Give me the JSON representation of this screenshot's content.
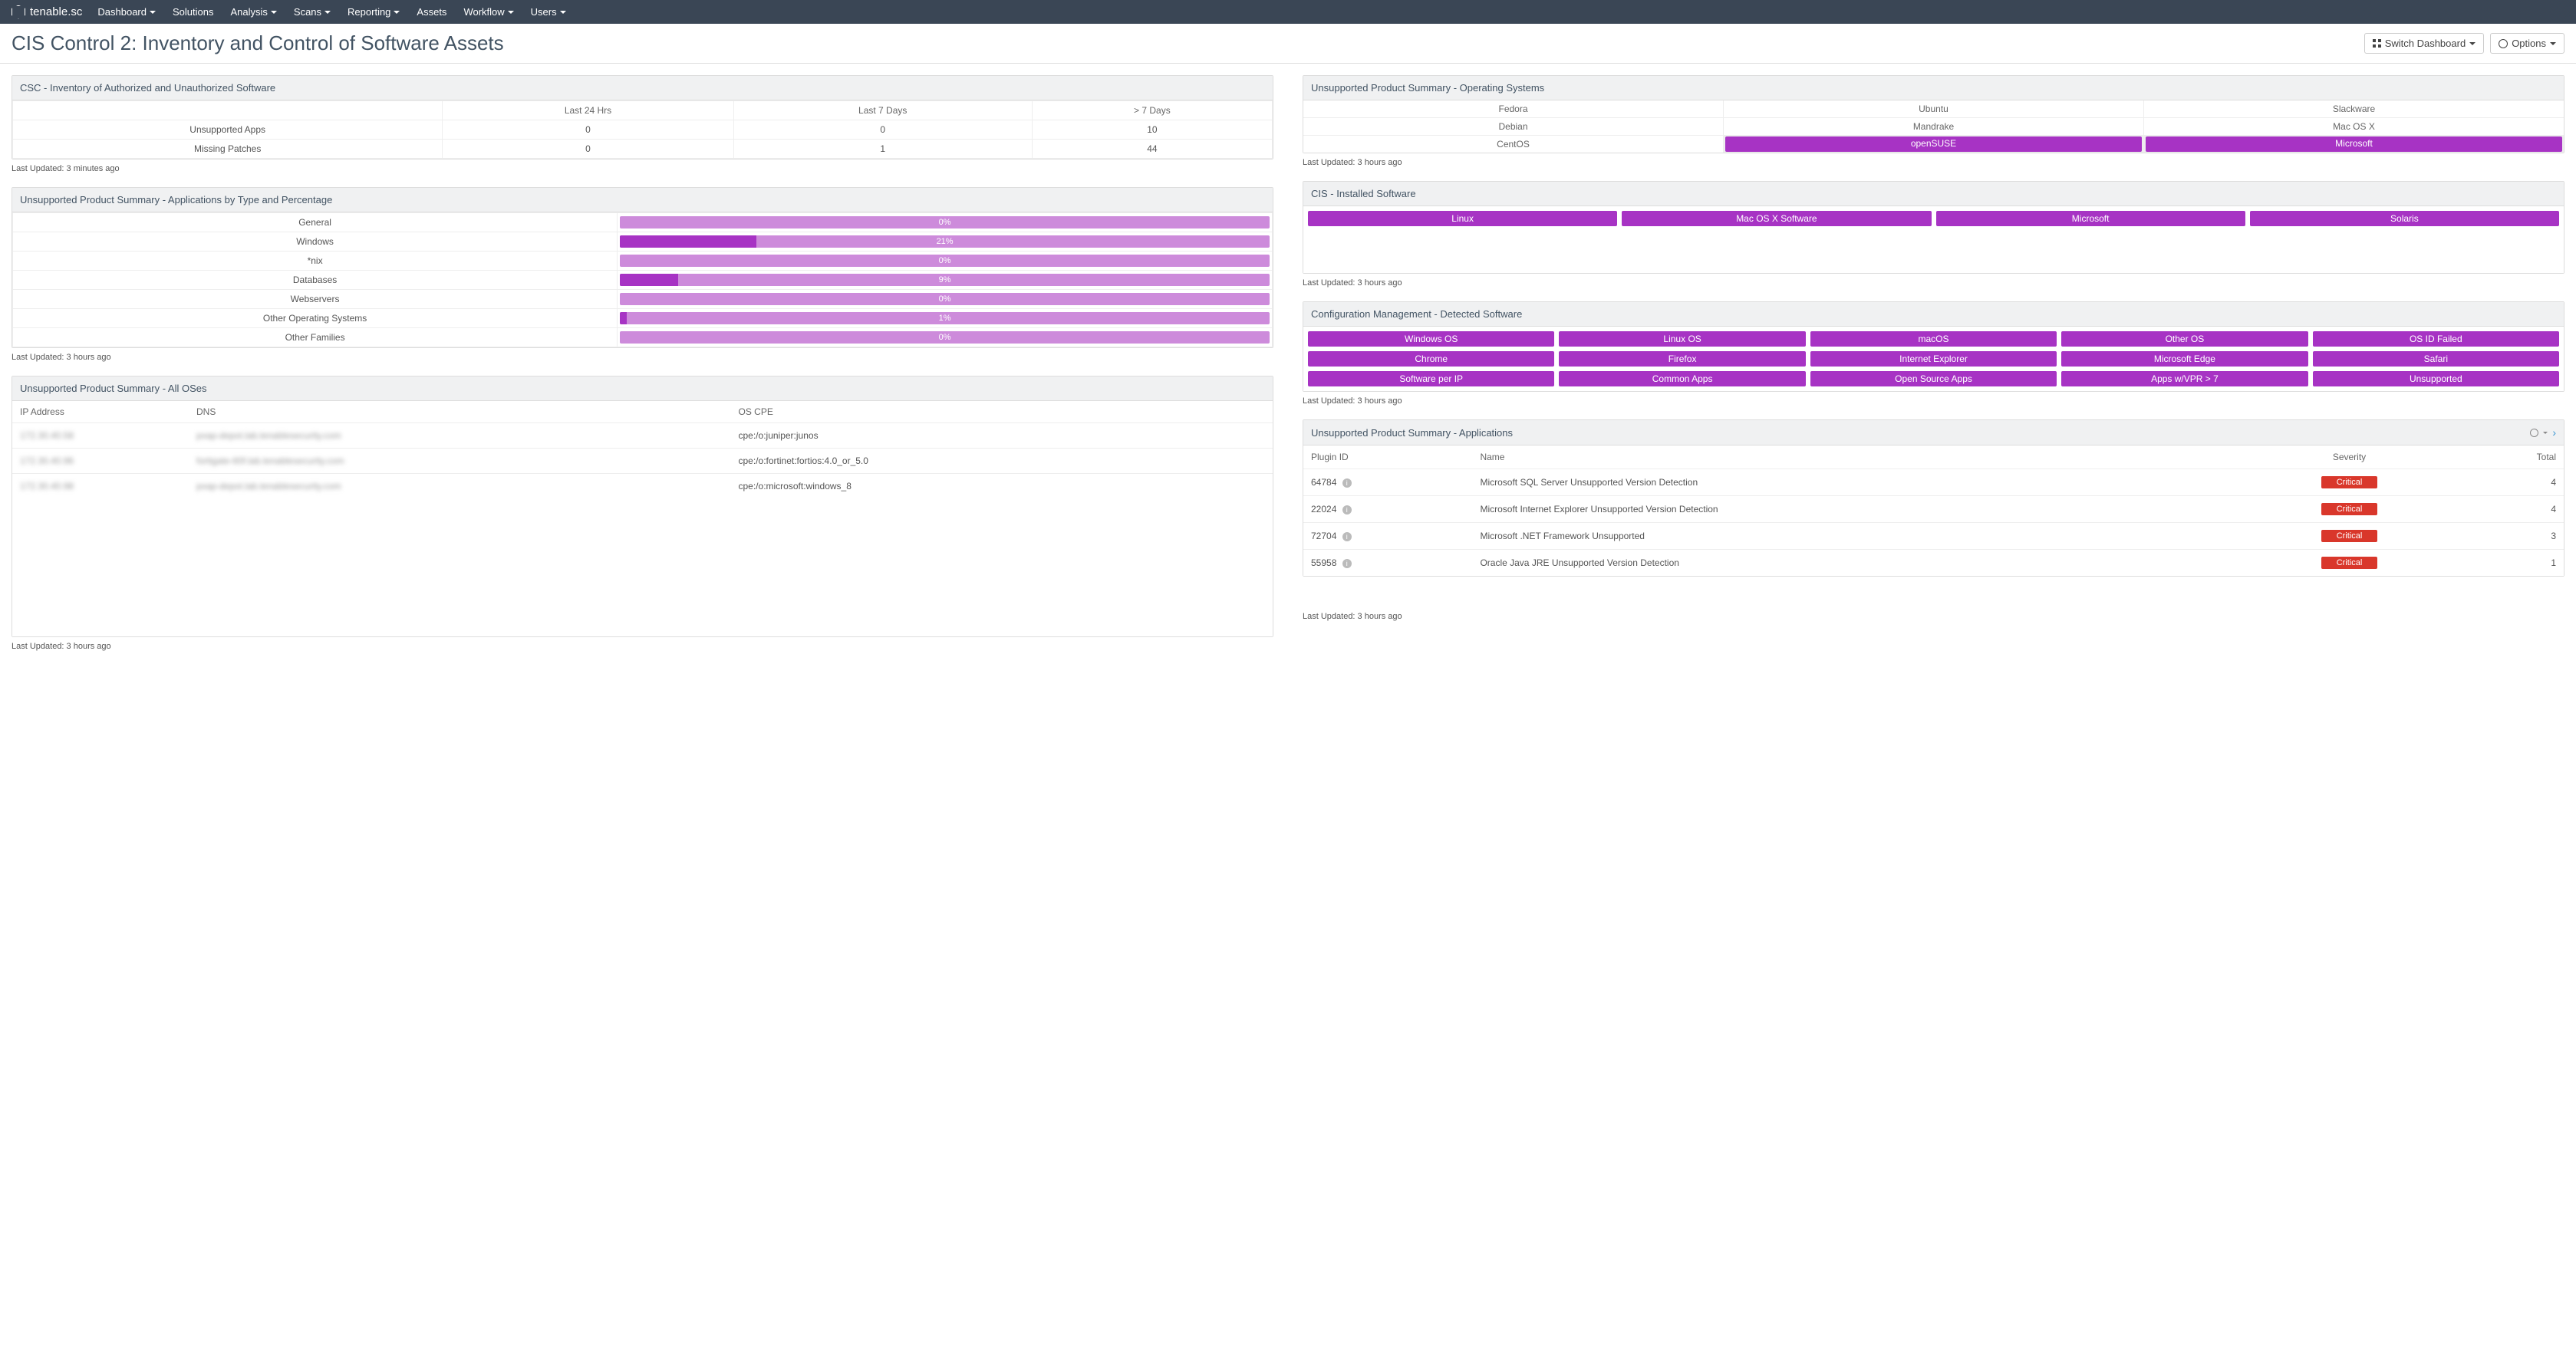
{
  "brand": "tenable.sc",
  "nav": [
    "Dashboard",
    "Solutions",
    "Analysis",
    "Scans",
    "Reporting",
    "Assets",
    "Workflow",
    "Users"
  ],
  "nav_caret": [
    true,
    false,
    true,
    true,
    true,
    false,
    true,
    true
  ],
  "page_title": "CIS Control 2: Inventory and Control of Software Assets",
  "switch_dash": "Switch Dashboard",
  "options": "Options",
  "panels": {
    "csc": {
      "title": "CSC - Inventory of Authorized and Unauthorized Software",
      "cols": [
        "",
        "Last 24 Hrs",
        "Last 7 Days",
        "> 7 Days"
      ],
      "rows": [
        {
          "label": "Unsupported Apps",
          "v": [
            "0",
            "0",
            "10"
          ]
        },
        {
          "label": "Missing Patches",
          "v": [
            "0",
            "1",
            "44"
          ]
        }
      ],
      "updated": "Last Updated: 3 minutes ago"
    },
    "apps_pct": {
      "title": "Unsupported Product Summary - Applications by Type and Percentage",
      "rows": [
        {
          "label": "General",
          "pct": 0,
          "txt": "0%"
        },
        {
          "label": "Windows",
          "pct": 21,
          "txt": "21%"
        },
        {
          "label": "*nix",
          "pct": 0,
          "txt": "0%"
        },
        {
          "label": "Databases",
          "pct": 9,
          "txt": "9%"
        },
        {
          "label": "Webservers",
          "pct": 0,
          "txt": "0%"
        },
        {
          "label": "Other Operating Systems",
          "pct": 1,
          "txt": "1%"
        },
        {
          "label": "Other Families",
          "pct": 0,
          "txt": "0%"
        }
      ],
      "updated": "Last Updated: 3 hours ago"
    },
    "all_oses": {
      "title": "Unsupported Product Summary - All OSes",
      "cols": [
        "IP Address",
        "DNS",
        "OS CPE"
      ],
      "rows": [
        {
          "ip": "172.30.40.58",
          "dns": "pxap-depot.lab.tenablesecurity.com",
          "cpe": "cpe:/o:juniper:junos"
        },
        {
          "ip": "172.30.40.96",
          "dns": "fortigate-60f.lab.tenablesecurity.com",
          "cpe": "cpe:/o:fortinet:fortios:4.0_or_5.0"
        },
        {
          "ip": "172.30.40.98",
          "dns": "pxap-depot.lab.tenablesecurity.com",
          "cpe": "cpe:/o:microsoft:windows_8"
        }
      ],
      "updated": "Last Updated: 3 hours ago"
    },
    "os_summary": {
      "title": "Unsupported Product Summary - Operating Systems",
      "grid": [
        [
          "Fedora",
          "Ubuntu",
          "Slackware"
        ],
        [
          "Debian",
          "Mandrake",
          "Mac OS X"
        ],
        [
          "CentOS",
          "openSUSE",
          "Microsoft"
        ]
      ],
      "filled": [
        [
          2,
          1
        ],
        [
          2,
          2
        ]
      ],
      "updated": "Last Updated: 3 hours ago"
    },
    "installed": {
      "title": "CIS - Installed Software",
      "chips": [
        "Linux",
        "Mac OS X Software",
        "Microsoft",
        "Solaris"
      ],
      "updated": "Last Updated: 3 hours ago"
    },
    "config_mgmt": {
      "title": "Configuration Management - Detected Software",
      "chips": [
        "Windows OS",
        "Linux OS",
        "macOS",
        "Other OS",
        "OS ID Failed",
        "Chrome",
        "Firefox",
        "Internet Explorer",
        "Microsoft Edge",
        "Safari",
        "Software per IP",
        "Common Apps",
        "Open Source Apps",
        "Apps w/VPR > 7",
        "Unsupported"
      ],
      "updated": "Last Updated: 3 hours ago"
    },
    "apps": {
      "title": "Unsupported Product Summary - Applications",
      "cols": [
        "Plugin ID",
        "Name",
        "Severity",
        "Total"
      ],
      "rows": [
        {
          "id": "64784",
          "name": "Microsoft SQL Server Unsupported Version Detection",
          "sev": "Critical",
          "total": "4"
        },
        {
          "id": "22024",
          "name": "Microsoft Internet Explorer Unsupported Version Detection",
          "sev": "Critical",
          "total": "4"
        },
        {
          "id": "72704",
          "name": "Microsoft .NET Framework Unsupported",
          "sev": "Critical",
          "total": "3"
        },
        {
          "id": "55958",
          "name": "Oracle Java JRE Unsupported Version Detection",
          "sev": "Critical",
          "total": "1"
        }
      ],
      "updated": "Last Updated: 3 hours ago"
    }
  }
}
